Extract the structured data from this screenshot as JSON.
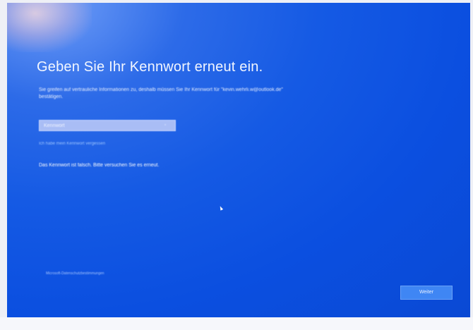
{
  "setup_screen": {
    "title": "Geben Sie Ihr Kennwort erneut ein.",
    "description": "Sie greifen auf vertrauliche Informationen zu, deshalb müssen Sie Ihr Kennwort für \"kevin.wehrli.w@outlook.de\" bestätigen.",
    "password_field": {
      "placeholder": "Kennwort",
      "value": "",
      "reveal_icon": "eye-icon"
    },
    "forgot_password_link": "Ich habe mein Kennwort vergessen",
    "error_message": "Das Kennwort ist falsch. Bitte versuchen Sie es erneut.",
    "privacy_link": "Microsoft-Datenschutzbestimmungen",
    "next_button": "Weiter"
  },
  "colors": {
    "screen_background": "#155ae4",
    "field_background": "#a9bdf5",
    "link_color": "#9cc4ff",
    "button_background": "#3f86f4"
  }
}
